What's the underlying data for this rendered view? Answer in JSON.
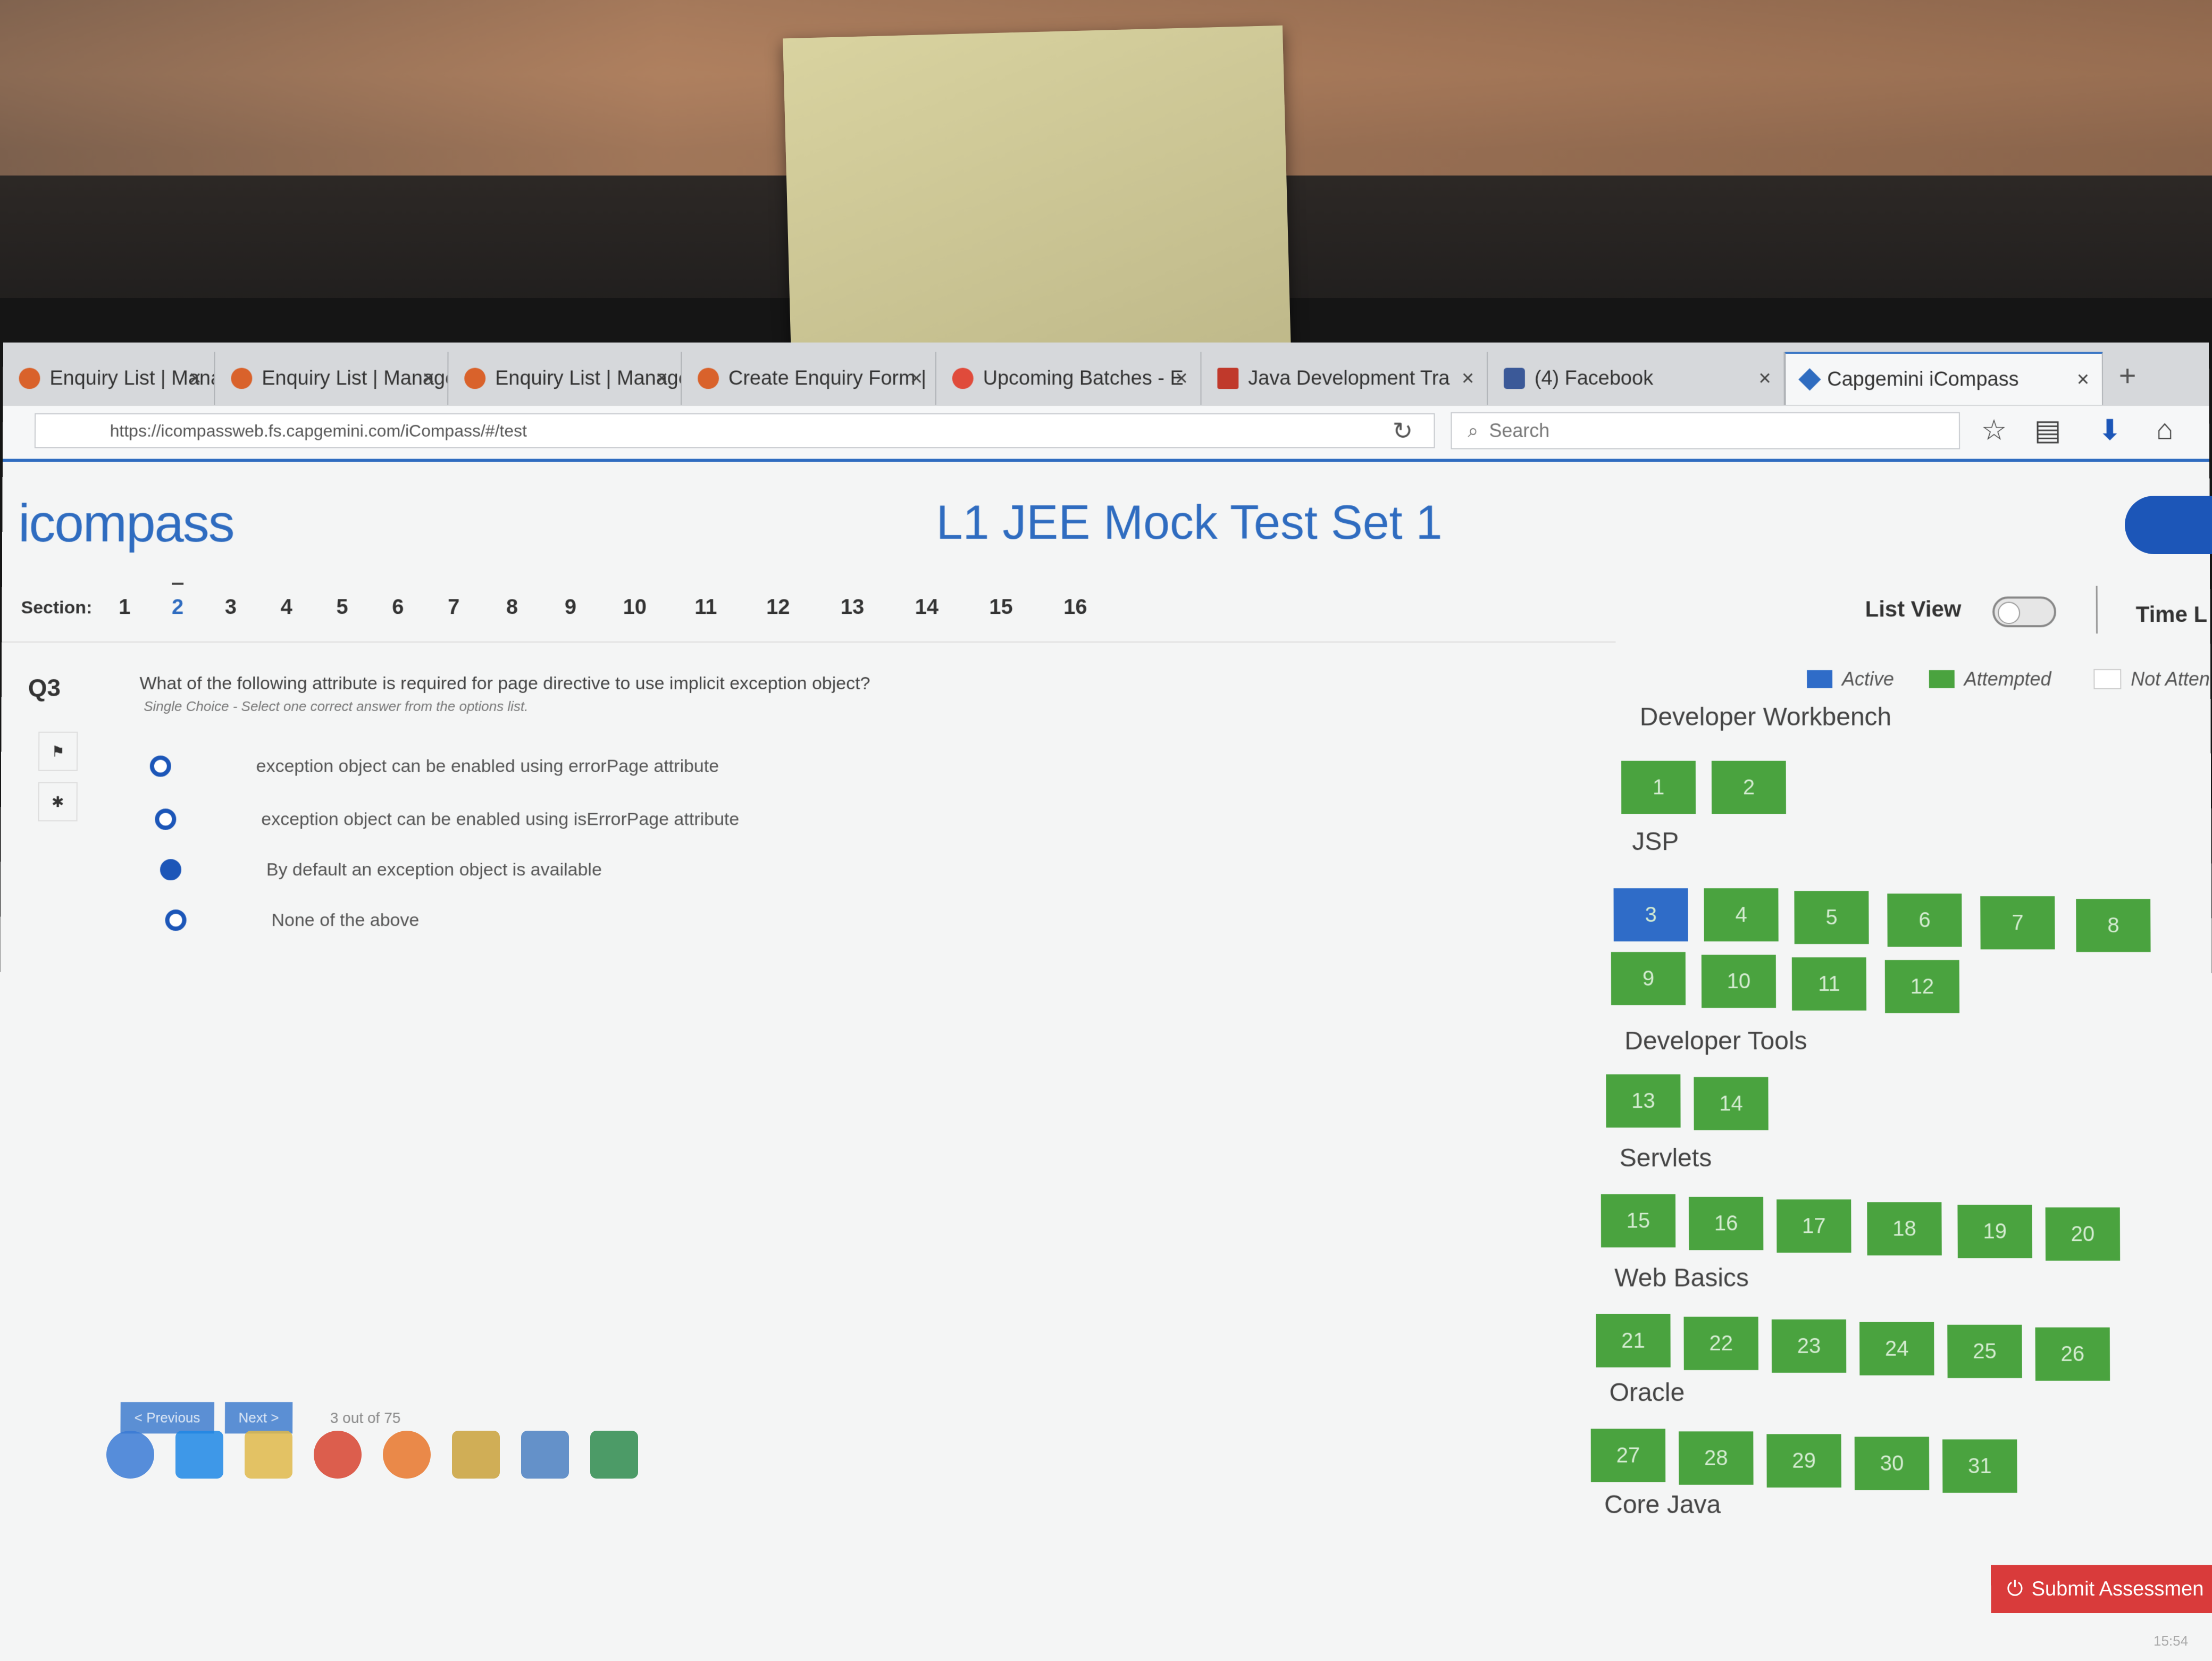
{
  "browser": {
    "tabs": [
      {
        "label": "Enquiry List | Manage"
      },
      {
        "label": "Enquiry List | Manage"
      },
      {
        "label": "Enquiry List | Manage"
      },
      {
        "label": "Create Enquiry Form |"
      },
      {
        "label": "Upcoming Batches - E"
      },
      {
        "label": "Java Development Tra"
      },
      {
        "label": "(4) Facebook"
      },
      {
        "label": "Capgemini iCompass"
      }
    ],
    "new_tab": "+",
    "url": "https://icompassweb.fs.capgemini.com/iCompass/#/test",
    "search_placeholder": "Search"
  },
  "app": {
    "logo": "icompass",
    "title": "L1 JEE Mock Test Set 1",
    "section_label": "Section:",
    "sections": [
      "1",
      "2",
      "3",
      "4",
      "5",
      "6",
      "7",
      "8",
      "9",
      "10",
      "11",
      "12",
      "13",
      "14",
      "15",
      "16"
    ],
    "active_section": "2",
    "list_view_label": "List View",
    "time_label": "Time L"
  },
  "question": {
    "number": "Q3",
    "text": "What of the following attribute is required for page directive to use implicit exception object?",
    "hint": "Single Choice - Select one correct answer from the options list.",
    "options": [
      "exception object can be enabled using errorPage attribute",
      "exception object can be enabled using isErrorPage attribute",
      "By default an exception object is available",
      "None of the above"
    ],
    "selected_index": 2,
    "previous_label": "< Previous",
    "next_label": "Next >",
    "progress": "3 out of 75"
  },
  "legend": {
    "active": "Active",
    "attempted": "Attempted",
    "not_attempted": "Not Atten",
    "colors": {
      "active": "#2f6cc8",
      "attempted": "#4aa33f",
      "not_attempted": "#ffffff"
    }
  },
  "palette": {
    "groups": [
      {
        "name": "Developer Workbench",
        "items": [
          "1",
          "2"
        ]
      },
      {
        "name": "JSP",
        "items": [
          "3",
          "4",
          "5",
          "6",
          "7",
          "8",
          "9",
          "10",
          "11",
          "12"
        ]
      },
      {
        "name": "Developer Tools",
        "items": [
          "13",
          "14"
        ]
      },
      {
        "name": "Servlets",
        "items": [
          "15",
          "16",
          "17",
          "18",
          "19",
          "20"
        ]
      },
      {
        "name": "Web Basics",
        "items": [
          "21",
          "22",
          "23",
          "24",
          "25",
          "26"
        ]
      },
      {
        "name": "Oracle",
        "items": [
          "27",
          "28",
          "29",
          "30",
          "31"
        ]
      },
      {
        "name": "Core Java",
        "items": []
      }
    ],
    "active_item": "3"
  },
  "submit_label": "Submit Assessmen",
  "clock": "15:54"
}
